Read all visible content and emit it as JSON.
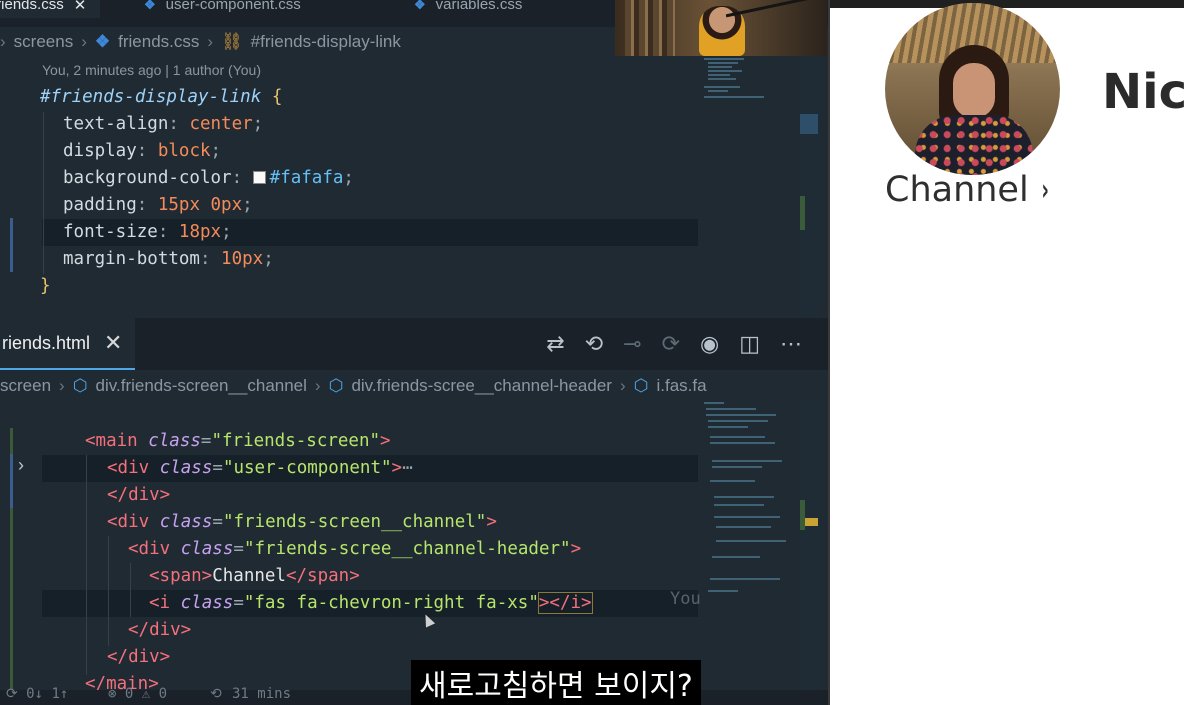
{
  "editor": {
    "top_tabs": [
      {
        "label": "friends.css",
        "close": "✕"
      },
      {
        "label": "user-component.css"
      },
      {
        "label": "variables.css"
      }
    ],
    "css_breadcrumb": {
      "items": [
        "screens",
        "friends.css",
        "#friends-display-link"
      ]
    },
    "blame": "You, 2 minutes ago | 1 author (You)",
    "css_code": {
      "selector": "#friends-display-link",
      "open_brace": "{",
      "close_brace": "}",
      "rules": [
        {
          "prop": "text-align",
          "value": "center"
        },
        {
          "prop": "display",
          "value": "block"
        },
        {
          "prop": "background-color",
          "value": "#fafafa"
        },
        {
          "prop": "padding",
          "value": "15px 0px"
        },
        {
          "prop": "font-size",
          "value": "18px"
        },
        {
          "prop": "margin-bottom",
          "value": "10px"
        }
      ]
    },
    "html_tab": {
      "label": "riends.html",
      "close": "✕"
    },
    "html_breadcrumb": {
      "items": [
        "screen",
        "div.friends-screen__channel",
        "div.friends-scree__channel-header",
        "i.fas.fa"
      ]
    },
    "html_code": {
      "l1": {
        "tag_open": "<main",
        "attr": "class",
        "value": "\"friends-screen\"",
        "tag_close": ">"
      },
      "l2": {
        "tag_open": "<div",
        "attr": "class",
        "value": "\"user-component\"",
        "tag_close": ">",
        "folded": "⋯"
      },
      "l3": {
        "text": "</div>"
      },
      "l4": {
        "tag_open": "<div",
        "attr": "class",
        "value": "\"friends-screen__channel\"",
        "tag_close": ">"
      },
      "l5": {
        "tag_open": "<div",
        "attr": "class",
        "value": "\"friends-scree__channel-header\"",
        "tag_close": ">"
      },
      "l6": {
        "open": "<span>",
        "text": "Channel",
        "close": "</span>"
      },
      "l7": {
        "tag_open": "<i",
        "attr": "class",
        "value": "\"fas fa-chevron-right fa-xs\"",
        "tag_close": "></i>"
      },
      "l8": {
        "text": "</div>"
      },
      "l9": {
        "text": "</div>"
      },
      "l10": {
        "text": "</main>"
      }
    },
    "ghost_blame": "You",
    "status_bar": {
      "sync": "⟳ 0↓ 1↑",
      "problems": "⊗ 0 ⚠ 0",
      "time": "31 mins"
    }
  },
  "preview": {
    "name": "Nico",
    "channel_label": "Channel",
    "channel_chevron": "›"
  },
  "subtitle": "새로고침하면 보이지?",
  "colors": {
    "editor_bg": "#1f2a33",
    "css_value": "#f58b5a",
    "html_tag": "#f5707a",
    "html_string": "#b7e56b",
    "accent": "#4ea7e8"
  }
}
